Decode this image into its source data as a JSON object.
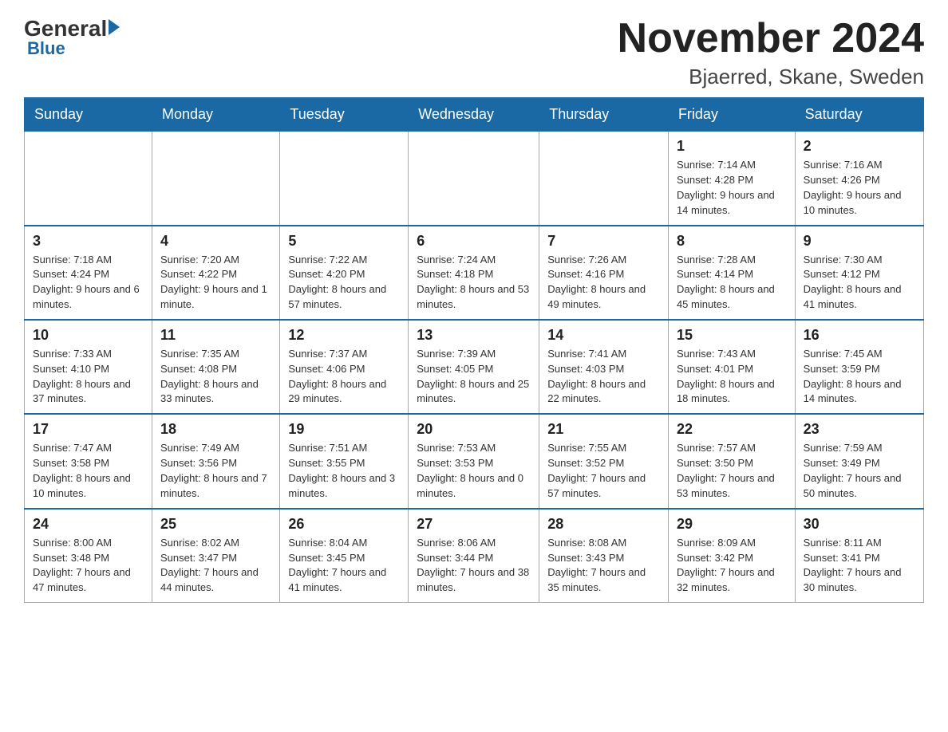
{
  "logo": {
    "general": "General",
    "blue": "Blue"
  },
  "header": {
    "month": "November 2024",
    "location": "Bjaerred, Skane, Sweden"
  },
  "weekdays": [
    "Sunday",
    "Monday",
    "Tuesday",
    "Wednesday",
    "Thursday",
    "Friday",
    "Saturday"
  ],
  "weeks": [
    [
      {
        "day": "",
        "info": ""
      },
      {
        "day": "",
        "info": ""
      },
      {
        "day": "",
        "info": ""
      },
      {
        "day": "",
        "info": ""
      },
      {
        "day": "",
        "info": ""
      },
      {
        "day": "1",
        "info": "Sunrise: 7:14 AM\nSunset: 4:28 PM\nDaylight: 9 hours and 14 minutes."
      },
      {
        "day": "2",
        "info": "Sunrise: 7:16 AM\nSunset: 4:26 PM\nDaylight: 9 hours and 10 minutes."
      }
    ],
    [
      {
        "day": "3",
        "info": "Sunrise: 7:18 AM\nSunset: 4:24 PM\nDaylight: 9 hours and 6 minutes."
      },
      {
        "day": "4",
        "info": "Sunrise: 7:20 AM\nSunset: 4:22 PM\nDaylight: 9 hours and 1 minute."
      },
      {
        "day": "5",
        "info": "Sunrise: 7:22 AM\nSunset: 4:20 PM\nDaylight: 8 hours and 57 minutes."
      },
      {
        "day": "6",
        "info": "Sunrise: 7:24 AM\nSunset: 4:18 PM\nDaylight: 8 hours and 53 minutes."
      },
      {
        "day": "7",
        "info": "Sunrise: 7:26 AM\nSunset: 4:16 PM\nDaylight: 8 hours and 49 minutes."
      },
      {
        "day": "8",
        "info": "Sunrise: 7:28 AM\nSunset: 4:14 PM\nDaylight: 8 hours and 45 minutes."
      },
      {
        "day": "9",
        "info": "Sunrise: 7:30 AM\nSunset: 4:12 PM\nDaylight: 8 hours and 41 minutes."
      }
    ],
    [
      {
        "day": "10",
        "info": "Sunrise: 7:33 AM\nSunset: 4:10 PM\nDaylight: 8 hours and 37 minutes."
      },
      {
        "day": "11",
        "info": "Sunrise: 7:35 AM\nSunset: 4:08 PM\nDaylight: 8 hours and 33 minutes."
      },
      {
        "day": "12",
        "info": "Sunrise: 7:37 AM\nSunset: 4:06 PM\nDaylight: 8 hours and 29 minutes."
      },
      {
        "day": "13",
        "info": "Sunrise: 7:39 AM\nSunset: 4:05 PM\nDaylight: 8 hours and 25 minutes."
      },
      {
        "day": "14",
        "info": "Sunrise: 7:41 AM\nSunset: 4:03 PM\nDaylight: 8 hours and 22 minutes."
      },
      {
        "day": "15",
        "info": "Sunrise: 7:43 AM\nSunset: 4:01 PM\nDaylight: 8 hours and 18 minutes."
      },
      {
        "day": "16",
        "info": "Sunrise: 7:45 AM\nSunset: 3:59 PM\nDaylight: 8 hours and 14 minutes."
      }
    ],
    [
      {
        "day": "17",
        "info": "Sunrise: 7:47 AM\nSunset: 3:58 PM\nDaylight: 8 hours and 10 minutes."
      },
      {
        "day": "18",
        "info": "Sunrise: 7:49 AM\nSunset: 3:56 PM\nDaylight: 8 hours and 7 minutes."
      },
      {
        "day": "19",
        "info": "Sunrise: 7:51 AM\nSunset: 3:55 PM\nDaylight: 8 hours and 3 minutes."
      },
      {
        "day": "20",
        "info": "Sunrise: 7:53 AM\nSunset: 3:53 PM\nDaylight: 8 hours and 0 minutes."
      },
      {
        "day": "21",
        "info": "Sunrise: 7:55 AM\nSunset: 3:52 PM\nDaylight: 7 hours and 57 minutes."
      },
      {
        "day": "22",
        "info": "Sunrise: 7:57 AM\nSunset: 3:50 PM\nDaylight: 7 hours and 53 minutes."
      },
      {
        "day": "23",
        "info": "Sunrise: 7:59 AM\nSunset: 3:49 PM\nDaylight: 7 hours and 50 minutes."
      }
    ],
    [
      {
        "day": "24",
        "info": "Sunrise: 8:00 AM\nSunset: 3:48 PM\nDaylight: 7 hours and 47 minutes."
      },
      {
        "day": "25",
        "info": "Sunrise: 8:02 AM\nSunset: 3:47 PM\nDaylight: 7 hours and 44 minutes."
      },
      {
        "day": "26",
        "info": "Sunrise: 8:04 AM\nSunset: 3:45 PM\nDaylight: 7 hours and 41 minutes."
      },
      {
        "day": "27",
        "info": "Sunrise: 8:06 AM\nSunset: 3:44 PM\nDaylight: 7 hours and 38 minutes."
      },
      {
        "day": "28",
        "info": "Sunrise: 8:08 AM\nSunset: 3:43 PM\nDaylight: 7 hours and 35 minutes."
      },
      {
        "day": "29",
        "info": "Sunrise: 8:09 AM\nSunset: 3:42 PM\nDaylight: 7 hours and 32 minutes."
      },
      {
        "day": "30",
        "info": "Sunrise: 8:11 AM\nSunset: 3:41 PM\nDaylight: 7 hours and 30 minutes."
      }
    ]
  ]
}
